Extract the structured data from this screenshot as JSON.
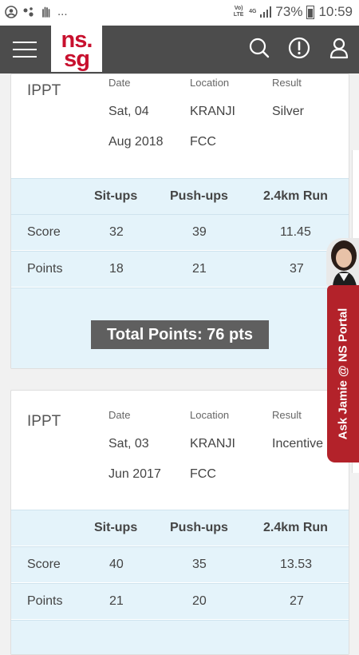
{
  "status_bar": {
    "left_icons": [
      "account-icon",
      "assistant-icon",
      "hand-icon"
    ],
    "dots": "...",
    "volte": "Vo) LTE",
    "network": "4G",
    "battery_percent": "73%",
    "time": "10:59"
  },
  "header": {
    "logo_line1": "ns.",
    "logo_line2": "sg",
    "icons": [
      "menu-icon",
      "search-icon",
      "alert-icon",
      "profile-icon"
    ]
  },
  "records": [
    {
      "title": "IPPT",
      "date_label": "Date",
      "date_line1": "Sat, 04",
      "date_line2": "Aug 2018",
      "location_label": "Location",
      "location_line1": "KRANJI",
      "location_line2": "FCC",
      "result_label": "Result",
      "result": "Silver",
      "headers": [
        "Sit-ups",
        "Push-ups",
        "2.4km Run"
      ],
      "score_label": "Score",
      "score": [
        "32",
        "39",
        "11.45"
      ],
      "points_label": "Points",
      "points": [
        "18",
        "21",
        "37"
      ],
      "total": "Total Points: 76 pts"
    },
    {
      "title": "IPPT",
      "date_label": "Date",
      "date_line1": "Sat, 03",
      "date_line2": "Jun 2017",
      "location_label": "Location",
      "location_line1": "KRANJI",
      "location_line2": "FCC",
      "result_label": "Result",
      "result": "Incentive",
      "headers": [
        "Sit-ups",
        "Push-ups",
        "2.4km Run"
      ],
      "score_label": "Score",
      "score": [
        "40",
        "35",
        "13.53"
      ],
      "points_label": "Points",
      "points": [
        "21",
        "20",
        "27"
      ]
    }
  ],
  "ask_jamie": {
    "label": "Ask Jamie @ NS Portal"
  },
  "colors": {
    "header": "#4c4c4c",
    "brand_red": "#c8102e",
    "table_bg": "#e4f3fa",
    "total_pill": "#5f5f5f",
    "jamie_tab": "#b3222a"
  }
}
